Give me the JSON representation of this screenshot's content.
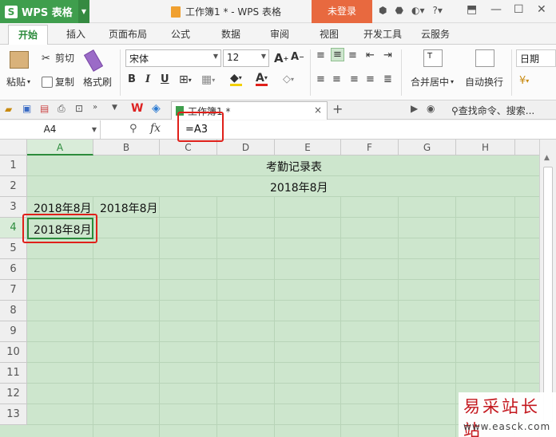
{
  "app": {
    "name": "WPS 表格",
    "logo": "S",
    "doc_title": "工作簿1 * - WPS 表格",
    "login": "未登录"
  },
  "tabs": [
    "开始",
    "插入",
    "页面布局",
    "公式",
    "数据",
    "审阅",
    "视图",
    "开发工具",
    "云服务"
  ],
  "ribbon": {
    "paste": "粘贴",
    "cut": "剪切",
    "copy": "复制",
    "format_painter": "格式刷",
    "font_name": "宋体",
    "font_size": "12",
    "bold": "B",
    "italic": "I",
    "underline": "U",
    "merge_center": "合并居中",
    "wrap_text": "自动换行",
    "number_format": "日期"
  },
  "doc_tab": {
    "label": "工作簿1 *",
    "close": "×",
    "add": "+",
    "search": "查找命令、搜索..."
  },
  "formula_bar": {
    "name_box": "A4",
    "formula": "=A3",
    "fx": "fx"
  },
  "sheet": {
    "columns": [
      "A",
      "B",
      "C",
      "D",
      "E",
      "F",
      "G",
      "H"
    ],
    "rows": [
      "1",
      "2",
      "3",
      "4",
      "5",
      "6",
      "7",
      "8",
      "9",
      "10",
      "11",
      "12",
      "13"
    ],
    "selected_column": "A",
    "selected_row": "4",
    "cells": {
      "title": "考勤记录表",
      "month_merged": "2018年8月",
      "A3": "2018年8月",
      "B3": "2018年8月",
      "A4": "2018年8月"
    }
  },
  "watermark": {
    "big": "易采站长站",
    "small": "www.easck.com"
  },
  "colors": {
    "accent": "#3f9e4d",
    "login": "#e8693f",
    "highlight_box": "#e0201a",
    "sheet_bg": "#cde6cd"
  }
}
